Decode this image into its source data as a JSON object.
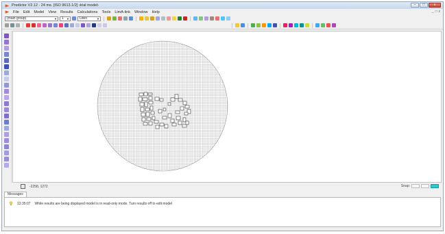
{
  "window": {
    "title": "Predictor V2.12 · 24 ms. [ISO 9613.1/2] ‹trial model›",
    "min": "–",
    "max": "□",
    "close": "x"
  },
  "menu": {
    "items": [
      "File",
      "Edit",
      "Model",
      "View",
      "Results",
      "Calculations",
      "Tools",
      "LimA-link",
      "Window",
      "Help"
    ],
    "mdi": [
      "_",
      "□",
      "x"
    ]
  },
  "toolbar": {
    "group_combo": "(main group)",
    "layer_combo": "1",
    "unit_combo": "Lden"
  },
  "status": {
    "coords": "-2258, 1272",
    "snap_label": "Snap:"
  },
  "messages": {
    "tab_label": "Messages",
    "rows": [
      {
        "time": "13:35:07",
        "text": "While results are being displayed model is in read-only mode. Turn results off to edit model"
      }
    ]
  },
  "colors": {
    "accent": "#2ecad3",
    "grid": "#8a8a8a",
    "buildings": "#3a3a3a"
  }
}
